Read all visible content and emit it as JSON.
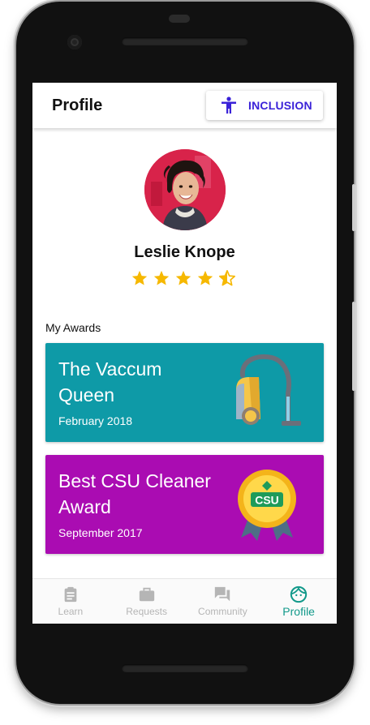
{
  "appbar": {
    "title": "Profile",
    "inclusion_button": {
      "label": "INCLUSION",
      "icon": "accessibility-icon"
    }
  },
  "profile": {
    "name": "Leslie Knope",
    "rating": 4.5,
    "rating_max": 5
  },
  "awards": {
    "section_label": "My Awards",
    "items": [
      {
        "title": "The Vaccum Queen",
        "date": "February 2018",
        "color": "#0e9aa7",
        "icon": "vacuum-cleaner-icon"
      },
      {
        "title": "Best CSU Cleaner Award",
        "date": "September 2017",
        "color": "#aa0cb2",
        "icon": "medal-icon",
        "badge_text": "CSU"
      }
    ]
  },
  "bottom_nav": {
    "items": [
      {
        "label": "Learn",
        "icon": "clipboard-icon",
        "active": false
      },
      {
        "label": "Requests",
        "icon": "briefcase-icon",
        "active": false
      },
      {
        "label": "Community",
        "icon": "chat-icon",
        "active": false
      },
      {
        "label": "Profile",
        "icon": "face-icon",
        "active": true
      }
    ]
  },
  "colors": {
    "accent": "#3a22d8",
    "active_nav": "#12998a",
    "star": "#f6b800"
  }
}
